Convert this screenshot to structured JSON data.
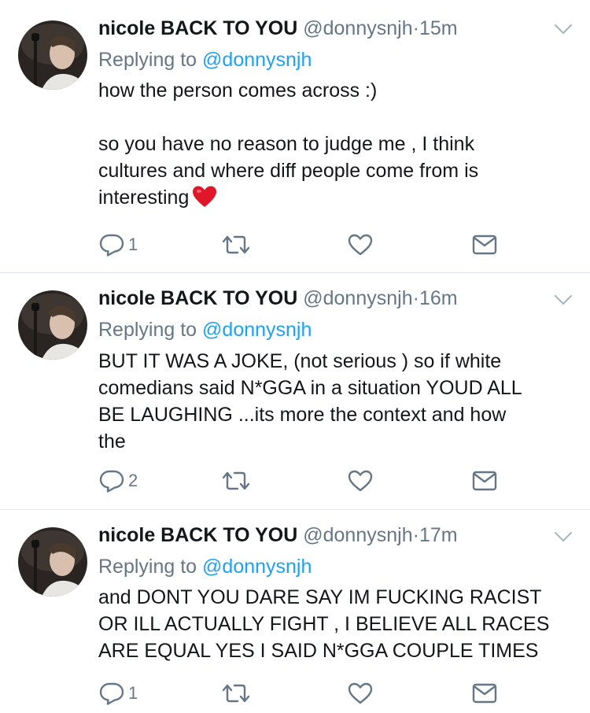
{
  "tweets": [
    {
      "name": "nicole BACK TO YOU",
      "handle": "@donnysnjh",
      "dot": "·",
      "time": "15m",
      "replying_label": "Replying to",
      "replying_to": "@donnysnjh",
      "lines": [
        "how the person comes across :)",
        "",
        "so you have no reason to judge me , I think",
        "cultures and where diff people come from is",
        "interesting"
      ],
      "emoji": "red-heart-emoji",
      "reply_count": "1",
      "retweet_count": "",
      "like_count": ""
    },
    {
      "name": "nicole BACK TO YOU",
      "handle": "@donnysnjh",
      "dot": "·",
      "time": "16m",
      "replying_label": "Replying to",
      "replying_to": "@donnysnjh",
      "lines": [
        "BUT IT WAS A JOKE, (not serious ) so if white",
        "comedians said N*GGA in a situation YOUD ALL",
        "BE LAUGHING ...its more the context and how",
        "the"
      ],
      "reply_count": "2",
      "retweet_count": "",
      "like_count": ""
    },
    {
      "name": "nicole BACK TO YOU",
      "handle": "@donnysnjh",
      "dot": "·",
      "time": "17m",
      "replying_label": "Replying to",
      "replying_to": "@donnysnjh",
      "lines": [
        "and DONT YOU DARE SAY IM FUCKING RACIST",
        "OR ILL ACTUALLY FIGHT , I BELIEVE ALL RACES",
        "ARE EQUAL YES I SAID N*GGA COUPLE TIMES"
      ],
      "reply_count": "1",
      "retweet_count": "",
      "like_count": ""
    }
  ],
  "icons": {
    "reply": "reply-icon",
    "retweet": "retweet-icon",
    "like": "like-icon",
    "dm": "direct-message-icon",
    "caret": "chevron-down-icon"
  },
  "colors": {
    "text": "#14171a",
    "secondary": "#657786",
    "link": "#1da1f2",
    "divider": "#e1e8ed"
  }
}
